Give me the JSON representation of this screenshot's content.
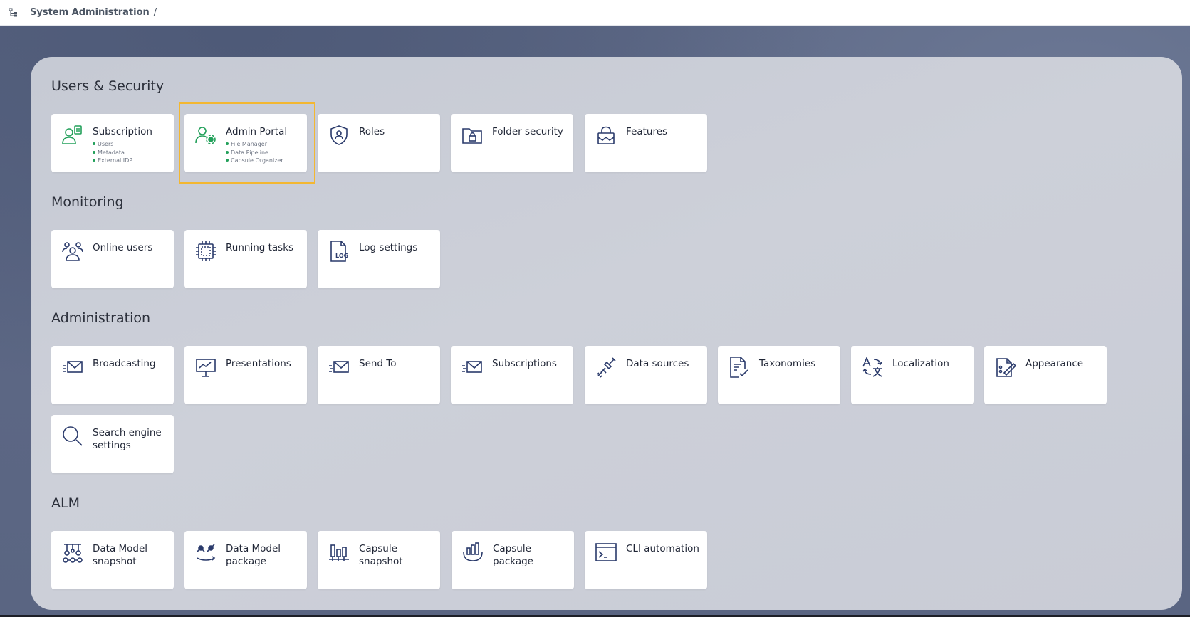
{
  "topbar": {
    "breadcrumb": "System Administration",
    "separator": "/"
  },
  "colors": {
    "accent_green": "#22a05a",
    "icon_navy": "#2a3a6b",
    "highlight": "#f3b731"
  },
  "sections": [
    {
      "title": "Users & Security",
      "tiles": [
        {
          "label": "Subscription",
          "icon": "user-subscription-icon",
          "sub": [
            "Users",
            "Metadata",
            "External IDP"
          ]
        },
        {
          "label": "Admin Portal",
          "icon": "user-gear-icon",
          "sub": [
            "File Manager",
            "Data Pipeline",
            "Capsule Organizer"
          ],
          "highlighted": true
        },
        {
          "label": "Roles",
          "icon": "shield-user-icon"
        },
        {
          "label": "Folder security",
          "icon": "folder-lock-icon"
        },
        {
          "label": "Features",
          "icon": "lock-features-icon"
        }
      ]
    },
    {
      "title": "Monitoring",
      "tiles": [
        {
          "label": "Online users",
          "icon": "users-group-icon"
        },
        {
          "label": "Running tasks",
          "icon": "chip-icon"
        },
        {
          "label": "Log settings",
          "icon": "log-file-icon"
        }
      ]
    },
    {
      "title": "Administration",
      "tiles": [
        {
          "label": "Broadcasting",
          "icon": "mail-send-icon"
        },
        {
          "label": "Presentations",
          "icon": "presentation-board-icon"
        },
        {
          "label": "Send To",
          "icon": "mail-send-icon"
        },
        {
          "label": "Subscriptions",
          "icon": "mail-send-icon"
        },
        {
          "label": "Data sources",
          "icon": "plug-icon"
        },
        {
          "label": "Taxonomies",
          "icon": "document-check-icon"
        },
        {
          "label": "Localization",
          "icon": "translate-icon"
        },
        {
          "label": "Appearance",
          "icon": "palette-document-icon"
        },
        {
          "label": "Search engine settings",
          "icon": "search-icon"
        }
      ]
    },
    {
      "title": "ALM",
      "tiles": [
        {
          "label": "Data Model snapshot",
          "icon": "model-snapshot-icon"
        },
        {
          "label": "Data Model package",
          "icon": "model-package-icon"
        },
        {
          "label": "Capsule snapshot",
          "icon": "bar-snapshot-icon"
        },
        {
          "label": "Capsule package",
          "icon": "bar-package-icon"
        },
        {
          "label": "CLI automation",
          "icon": "terminal-icon"
        }
      ]
    }
  ]
}
